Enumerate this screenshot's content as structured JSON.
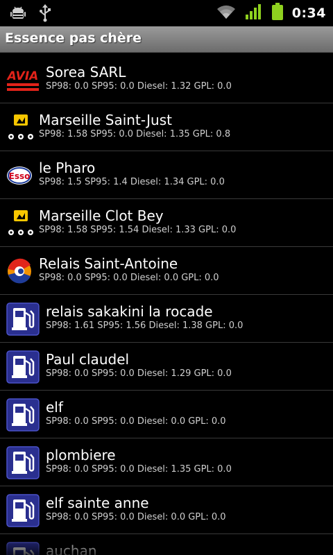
{
  "status_bar": {
    "time": "0:34",
    "icons": [
      "android-debug-icon",
      "usb-icon",
      "wifi-icon",
      "signal-icon",
      "battery-icon"
    ]
  },
  "app": {
    "title": "Essence pas chère"
  },
  "stations": [
    {
      "name": "Sorea SARL",
      "prices": "SP98: 0.0 SP95: 0.0 Diesel: 1.32 GPL: 0.0",
      "brand": "avia"
    },
    {
      "name": "Marseille Saint-Just",
      "prices": "SP98: 1.58 SP95: 0.0 Diesel: 1.35 GPL: 0.8",
      "brand": "carrefour"
    },
    {
      "name": "le Pharo",
      "prices": "SP98: 1.5 SP95: 1.4 Diesel: 1.34 GPL: 0.0",
      "brand": "esso"
    },
    {
      "name": "Marseille Clot Bey",
      "prices": "SP98: 1.58 SP95: 1.54 Diesel: 1.33 GPL: 0.0",
      "brand": "carrefour"
    },
    {
      "name": "Relais Saint-Antoine",
      "prices": "SP98: 0.0 SP95: 0.0 Diesel: 0.0 GPL: 0.0",
      "brand": "total"
    },
    {
      "name": "relais sakakini la rocade",
      "prices": "SP98: 1.61 SP95: 1.56 Diesel: 1.38 GPL: 0.0",
      "brand": "generic"
    },
    {
      "name": "Paul claudel",
      "prices": "SP98: 0.0 SP95: 0.0 Diesel: 1.29 GPL: 0.0",
      "brand": "generic"
    },
    {
      "name": "elf",
      "prices": "SP98: 0.0 SP95: 0.0 Diesel: 0.0 GPL: 0.0",
      "brand": "generic"
    },
    {
      "name": "plombiere",
      "prices": "SP98: 0.0 SP95: 0.0 Diesel: 1.35 GPL: 0.0",
      "brand": "generic"
    },
    {
      "name": "elf sainte anne",
      "prices": "SP98: 0.0 SP95: 0.0 Diesel: 0.0 GPL: 0.0",
      "brand": "generic"
    },
    {
      "name": "auchan",
      "prices": "",
      "brand": "generic"
    }
  ],
  "brand_logo_text": {
    "avia": "AVIA",
    "esso": "Esso"
  },
  "colors": {
    "title_bar": "#8a8a8a",
    "generic_icon_bg": "#2a2f8f",
    "avia_red": "#e2231a",
    "esso_red": "#d0021b",
    "esso_blue": "#1a3b9b",
    "carrefour_yellow": "#f7c600",
    "total_red": "#e1251b",
    "total_blue": "#1f3c99",
    "total_orange": "#f39200"
  }
}
